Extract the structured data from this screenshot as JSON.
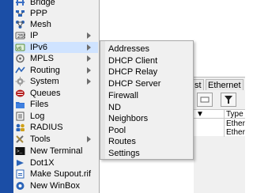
{
  "main_menu": {
    "items": [
      {
        "label": "Bridge",
        "icon": "bridge-icon",
        "has_submenu": false
      },
      {
        "label": "PPP",
        "icon": "ppp-icon",
        "has_submenu": false
      },
      {
        "label": "Mesh",
        "icon": "mesh-icon",
        "has_submenu": false
      },
      {
        "label": "IP",
        "icon": "ip-icon",
        "has_submenu": true
      },
      {
        "label": "IPv6",
        "icon": "ipv6-icon",
        "has_submenu": true,
        "selected": true
      },
      {
        "label": "MPLS",
        "icon": "mpls-icon",
        "has_submenu": true
      },
      {
        "label": "Routing",
        "icon": "routing-icon",
        "has_submenu": true
      },
      {
        "label": "System",
        "icon": "system-gear-icon",
        "has_submenu": true
      },
      {
        "label": "Queues",
        "icon": "queues-icon",
        "has_submenu": false
      },
      {
        "label": "Files",
        "icon": "files-icon",
        "has_submenu": false
      },
      {
        "label": "Log",
        "icon": "log-icon",
        "has_submenu": false
      },
      {
        "label": "RADIUS",
        "icon": "radius-icon",
        "has_submenu": false
      },
      {
        "label": "Tools",
        "icon": "tools-icon",
        "has_submenu": true
      },
      {
        "label": "New Terminal",
        "icon": "terminal-icon",
        "has_submenu": false
      },
      {
        "label": "Dot1X",
        "icon": "dot1x-icon",
        "has_submenu": false
      },
      {
        "label": "Make Supout.rif",
        "icon": "supout-icon",
        "has_submenu": false
      },
      {
        "label": "New WinBox",
        "icon": "winbox-icon",
        "has_submenu": false
      }
    ]
  },
  "ipv6_submenu": {
    "items": [
      "Addresses",
      "DHCP Client",
      "DHCP Relay",
      "DHCP Server",
      "Firewall",
      "ND",
      "Neighbors",
      "Pool",
      "Routes",
      "Settings"
    ]
  },
  "background_window": {
    "tabs": [
      "st",
      "Ethernet"
    ],
    "column_header": "Type",
    "rows": [
      "Ether",
      "Ether"
    ]
  },
  "colors": {
    "strip": "#1b4ea6",
    "menu_bg": "#f0f0f0",
    "selected_bg": "#cfe3ff"
  }
}
